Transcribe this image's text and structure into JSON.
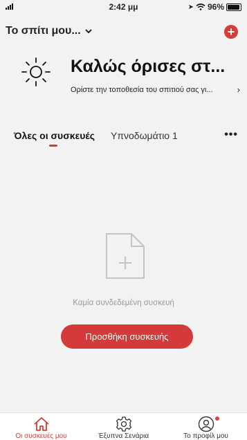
{
  "status_bar": {
    "time": "2:42 μμ",
    "battery": "96%",
    "battery_level": 0.96
  },
  "header": {
    "home_name": "Το σπίτι μου...",
    "dropdown_icon": "chevron-down-icon",
    "add_icon": "plus-circle-icon",
    "accent_color": "#d63a3a"
  },
  "welcome": {
    "icon": "sun-icon",
    "title": "Καλώς όρισες στ...",
    "subtitle": "Ορίστε την τοποθεσία του σπιτιού σας γι...",
    "chevron": "›"
  },
  "tabs": {
    "items": [
      {
        "label": "Όλες οι συσκευές",
        "active": true
      },
      {
        "label": "Υπνοδωμάτιο 1",
        "active": false
      }
    ],
    "more_label": "•••"
  },
  "empty_state": {
    "icon": "add-file-icon",
    "message": "Καμία συνδεδεμένη συσκευή",
    "button_label": "Προσθήκη συσκευής"
  },
  "bottom_nav": {
    "items": [
      {
        "label": "Οι συσκευές μου",
        "icon": "home-icon",
        "active": true
      },
      {
        "label": "Έξυπνα Σενάρια",
        "icon": "gear-icon",
        "active": false
      },
      {
        "label": "Το προφίλ μου",
        "icon": "profile-icon",
        "active": false
      }
    ]
  }
}
